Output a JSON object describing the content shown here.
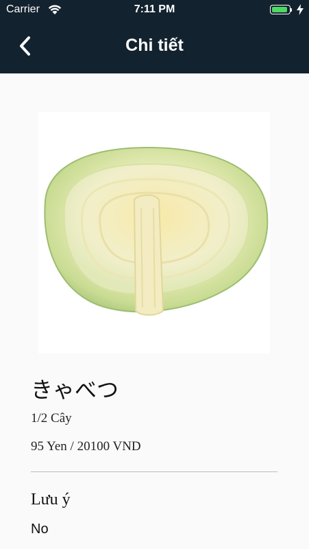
{
  "status_bar": {
    "carrier": "Carrier",
    "time": "7:11 PM"
  },
  "nav": {
    "title": "Chi tiết",
    "back_icon": "chevron-left-icon"
  },
  "product": {
    "image_alt": "cabbage",
    "name": "きゃべつ",
    "quantity": "1/2 Cây",
    "price": "95 Yen / 20100 VND"
  },
  "note": {
    "label": "Lưu ý",
    "value": "No"
  },
  "colors": {
    "nav_background": "#13222f",
    "page_background": "#fafafa",
    "battery": "#4cd964"
  }
}
